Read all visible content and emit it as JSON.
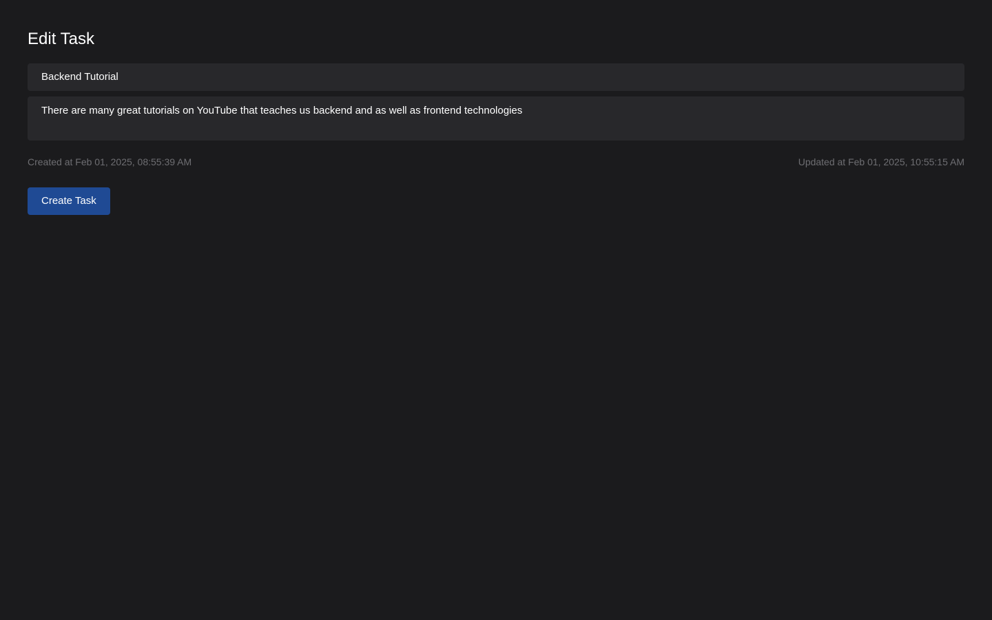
{
  "page": {
    "title": "Edit Task"
  },
  "form": {
    "title_value": "Backend Tutorial",
    "description_value": "There are many great tutorials on YouTube that teaches us backend and as well as frontend technologies"
  },
  "meta": {
    "created": "Created at Feb 01, 2025, 08:55:39 AM",
    "updated": "Updated at Feb 01, 2025, 10:55:15 AM"
  },
  "actions": {
    "submit_label": "Create Task"
  },
  "colors": {
    "background": "#1b1b1d",
    "field_background": "#28282b",
    "muted_text": "#6e6e72",
    "accent": "#1f4a94"
  }
}
